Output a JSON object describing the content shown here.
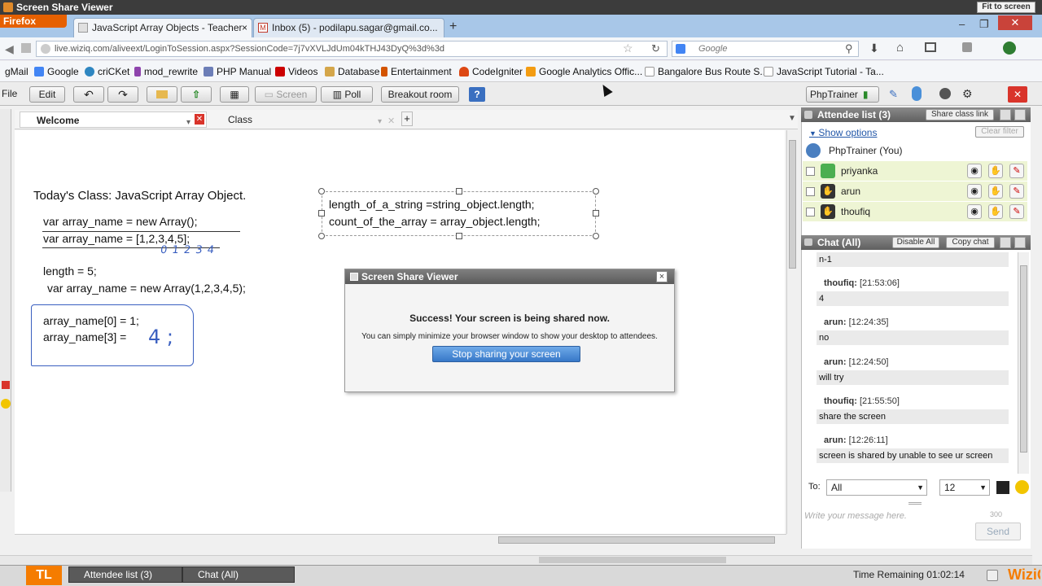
{
  "window": {
    "title": "Screen Share Viewer",
    "fit_button": "Fit to screen",
    "minimize": "–",
    "restore": "❐",
    "close": "✕"
  },
  "browser": {
    "menu_button": "Firefox",
    "tabs": [
      {
        "label": "JavaScript Array Objects - Teacher",
        "close": "×"
      },
      {
        "label": "Inbox (5) - podilapu.sagar@gmail.co...",
        "close": "×"
      }
    ],
    "new_tab": "+",
    "url": "live.wiziq.com/aliveext/LoginToSession.aspx?SessionCode=7j7vXVLJdUm04kTHJ43DyQ%3d%3d",
    "search_placeholder": "Google",
    "bookmarks": [
      {
        "label": "gMail",
        "color": "#c0392b"
      },
      {
        "label": "Google",
        "color": "#4285f4"
      },
      {
        "label": "criCKet",
        "color": "#2e86c1"
      },
      {
        "label": "mod_rewrite",
        "color": "#8e44ad"
      },
      {
        "label": "PHP Manual",
        "color": "#6c7eb7"
      },
      {
        "label": "Videos",
        "color": "#cc0000"
      },
      {
        "label": "Database",
        "color": "#555555"
      },
      {
        "label": "Entertainment",
        "color": "#d35400"
      },
      {
        "label": "CodeIgniter",
        "color": "#dd4814"
      },
      {
        "label": "Google Analytics Offic...",
        "color": "#f39c12"
      },
      {
        "label": "Bangalore Bus Route S...",
        "color": "#dddddd"
      },
      {
        "label": "JavaScript Tutorial - Ta...",
        "color": "#dddddd"
      }
    ]
  },
  "toolbar": {
    "file": "File",
    "edit": "Edit",
    "screen": "Screen",
    "poll": "Poll",
    "breakout": "Breakout room",
    "help": "?",
    "user": "PhpTrainer"
  },
  "doc_tabs": {
    "welcome": "Welcome",
    "class": "Class",
    "add": "+"
  },
  "whiteboard": {
    "heading": "Today's Class: JavaScript Array Object.",
    "line1": "var array_name = new Array();",
    "line2": "var array_name = [1,2,3,4,5];",
    "indices": "0 1 2 3 4",
    "line3": "length = 5;",
    "line4": "var array_name = new Array(1,2,3,4,5);",
    "line5": "array_name[0] = 1;",
    "line6": "array_name[3] = ",
    "handwritten": "4 ;",
    "box_line1": "length_of_a_string =string_object.length;",
    "box_line2": "count_of_the_array = array_object.length;"
  },
  "dialog": {
    "title": "Screen Share Viewer",
    "close": "×",
    "success": "Success! Your screen is being shared now.",
    "info": "You can simply minimize your browser window to show your desktop to attendees.",
    "stop_button": "Stop sharing your screen"
  },
  "attendees": {
    "header": "Attendee list (3)",
    "share_link": "Share class link",
    "show_options": "Show options",
    "clear_filter": "Clear filter",
    "presenter": "PhpTrainer (You)",
    "list": [
      {
        "name": "priyanka"
      },
      {
        "name": "arun"
      },
      {
        "name": "thoufiq"
      }
    ]
  },
  "chat": {
    "header": "Chat (All)",
    "disable_all": "Disable All",
    "copy_chat": "Copy chat",
    "first_msg": "n-1",
    "messages": [
      {
        "name": "thoufiq:",
        "time": "[21:53:06]",
        "text": "4"
      },
      {
        "name": "arun:",
        "time": "[12:24:35]",
        "text": "no"
      },
      {
        "name": "arun:",
        "time": "[12:24:50]",
        "text": "will try"
      },
      {
        "name": "thoufiq:",
        "time": "[21:55:50]",
        "text": "share the screen"
      },
      {
        "name": "arun:",
        "time": "[12:26:11]",
        "text": "screen is shared by unable to see ur screen"
      }
    ],
    "to_label": "To:",
    "to_value": "All",
    "font_size": "12",
    "input_placeholder": "Write your message here.",
    "char_count": "300",
    "send": "Send"
  },
  "statusbar": {
    "tl": "TL",
    "attendee_tab": "Attendee list (3)",
    "chat_tab": "Chat (All)",
    "time_remaining_label": "Time Remaining",
    "time_remaining": "01:02:14",
    "brand": "WiziQ"
  }
}
